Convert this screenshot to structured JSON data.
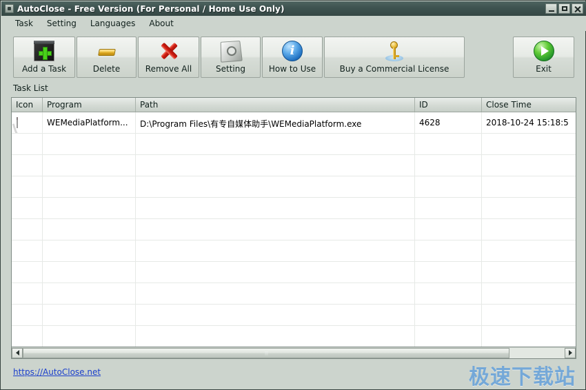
{
  "window": {
    "title": "AutoClose - Free Version (For Personal / Home Use Only)",
    "icon": "app-icon",
    "controls": {
      "minimize": "minimize-button",
      "maximize": "maximize-button",
      "close": "close-button"
    }
  },
  "menu": {
    "items": [
      {
        "label": "Task"
      },
      {
        "label": "Setting"
      },
      {
        "label": "Languages"
      },
      {
        "label": "About"
      }
    ]
  },
  "toolbar": {
    "buttons": [
      {
        "label": "Add a Task",
        "icon": "add-task-icon"
      },
      {
        "label": "Delete",
        "icon": "delete-icon"
      },
      {
        "label": "Remove All",
        "icon": "remove-all-icon"
      },
      {
        "label": "Setting",
        "icon": "setting-icon"
      },
      {
        "label": "How to Use",
        "icon": "info-icon"
      },
      {
        "label": "Buy a Commercial License",
        "icon": "key-icon"
      },
      {
        "label": "Exit",
        "icon": "exit-icon"
      }
    ]
  },
  "tasklist": {
    "caption": "Task List",
    "columns": [
      "Icon",
      "Program",
      "Path",
      "ID",
      "Close Time"
    ],
    "rows": [
      {
        "icon": "program-thumbnail",
        "program": "WEMediaPlatform...",
        "path": "D:\\Program Files\\有专自媒体助手\\WEMediaPlatform.exe",
        "id": "4628",
        "close_time": "2018-10-24 15:18:5"
      }
    ],
    "empty_row_count": 10
  },
  "scrollbar": {
    "left_arrow": "scroll-left-arrow",
    "right_arrow": "scroll-right-arrow"
  },
  "footer": {
    "link": "https://AutoClose.net",
    "watermark": "极速下载站"
  },
  "colors": {
    "titlebar": "#3e5350",
    "window_bg": "#ccd4cd",
    "link": "#1b3fcc",
    "watermark": "#74a8d8",
    "accent_green": "#49d11a",
    "accent_red": "#d32013",
    "accent_blue": "#1f6fc0",
    "accent_gold": "#d9a520"
  }
}
